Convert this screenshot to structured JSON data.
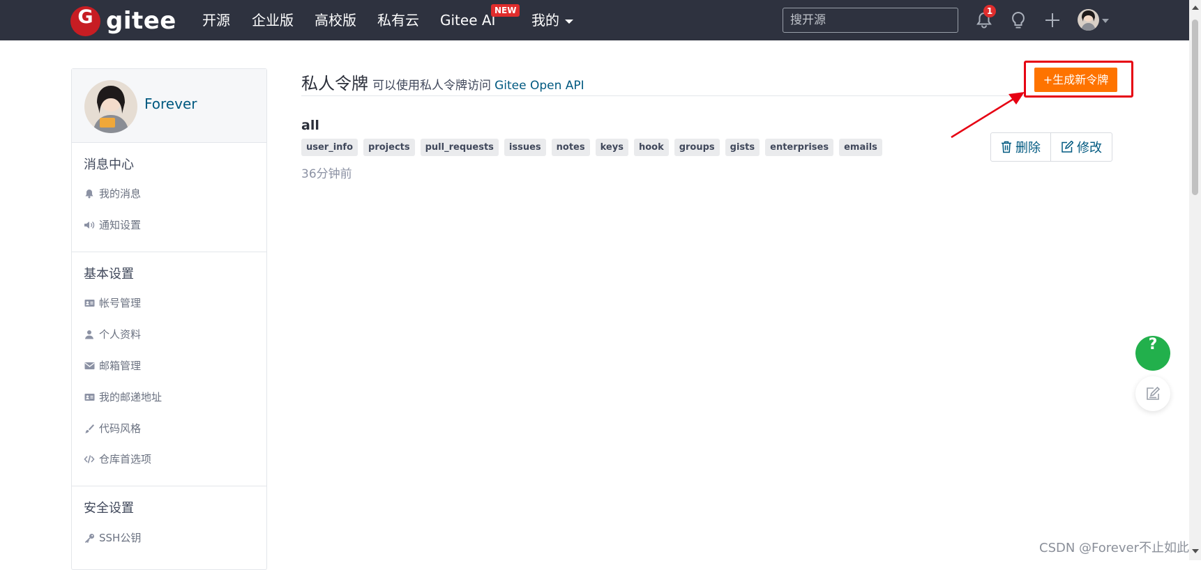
{
  "nav": {
    "logo_letter": "G",
    "logo_text": "gitee",
    "items": [
      "开源",
      "企业版",
      "高校版",
      "私有云",
      "Gitee AI",
      "我的"
    ],
    "new_badge": "NEW",
    "search_placeholder": "搜开源",
    "notification_count": "1"
  },
  "sidebar": {
    "username": "Forever",
    "sections": [
      {
        "title": "消息中心",
        "items": [
          {
            "label": "我的消息",
            "icon": "bell-icon"
          },
          {
            "label": "通知设置",
            "icon": "volume-icon"
          }
        ]
      },
      {
        "title": "基本设置",
        "items": [
          {
            "label": "帐号管理",
            "icon": "id-card-icon"
          },
          {
            "label": "个人资料",
            "icon": "user-icon"
          },
          {
            "label": "邮箱管理",
            "icon": "envelope-icon"
          },
          {
            "label": "我的邮递地址",
            "icon": "address-card-icon"
          },
          {
            "label": "代码风格",
            "icon": "brush-icon"
          },
          {
            "label": "仓库首选项",
            "icon": "code-icon"
          }
        ]
      },
      {
        "title": "安全设置",
        "items": [
          {
            "label": "SSH公钥",
            "icon": "key-icon"
          }
        ]
      }
    ]
  },
  "main": {
    "title": "私人令牌",
    "subtitle": "可以使用私人令牌访问",
    "api_link": "Gitee Open API",
    "generate_button": "+生成新令牌",
    "token": {
      "name": "all",
      "scopes": [
        "user_info",
        "projects",
        "pull_requests",
        "issues",
        "notes",
        "keys",
        "hook",
        "groups",
        "gists",
        "enterprises",
        "emails"
      ],
      "time": "36分钟前",
      "delete_label": "删除",
      "edit_label": "修改"
    }
  },
  "floating": {
    "help_symbol": "?"
  },
  "watermark": "CSDN @Forever不止如此",
  "colors": {
    "nav_bg": "#2e323f",
    "accent_orange": "#fe7300",
    "link_blue": "#005980",
    "highlight_red": "#e60012",
    "help_green": "#22b04c"
  }
}
